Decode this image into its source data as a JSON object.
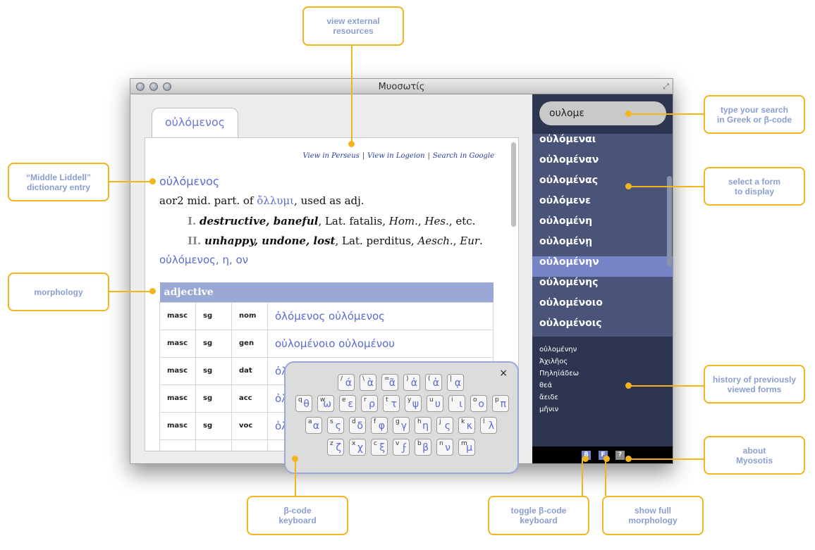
{
  "window": {
    "title": "Μυοσωτίς"
  },
  "tab": {
    "label": "οὐλόμενος"
  },
  "external": {
    "perseus": "View in Perseus",
    "logeion": "View in Logeion",
    "google": "Search in Google",
    "sep": "|"
  },
  "entry": {
    "headword": "οὐλόμενος",
    "def_prefix": "aor2 mid. part. of ",
    "def_ref": "ὄλλυμι",
    "def_suffix": ", used as adj.",
    "sense1": {
      "num": "I.",
      "bold": "destructive, baneful",
      "text1": ", Lat. fatalis, ",
      "ref1": "Hom.",
      "sep1": ", ",
      "ref2": "Hes.",
      "text2": ", etc."
    },
    "sense2": {
      "num": "II.",
      "bold": "unhappy, undone, lost",
      "text1": ", Lat. perditus, ",
      "ref1": "Aesch.",
      "sep1": ", ",
      "ref2": "Eur",
      "text2": "."
    },
    "lemma": "οὐλόμενος, η, ον"
  },
  "morphology": {
    "header": "adjective",
    "rows": [
      {
        "gender": "masc",
        "number": "sg",
        "case": "nom",
        "forms": "ὀλόμενος  οὐλόμενος"
      },
      {
        "gender": "masc",
        "number": "sg",
        "case": "gen",
        "forms": "οὐλομένοιο  οὐλομένου"
      },
      {
        "gender": "masc",
        "number": "sg",
        "case": "dat",
        "forms": "ὀλ"
      },
      {
        "gender": "masc",
        "number": "sg",
        "case": "acc",
        "forms": "ὀλ"
      },
      {
        "gender": "masc",
        "number": "sg",
        "case": "voc",
        "forms": "ὀλ"
      },
      {
        "gender": "",
        "number": "",
        "case": "",
        "forms": ""
      }
    ]
  },
  "search": {
    "value": "ουλομε"
  },
  "forms": [
    "οὐλόμεναι",
    "οὐλομέναν",
    "οὐλομένας",
    "οὐλόμενε",
    "οὐλομένη",
    "οὐλομένῃ",
    "οὐλομένην",
    "οὐλομένης",
    "οὐλομένοιο",
    "οὐλομένοις"
  ],
  "history": [
    "οὐλομένην",
    "Ἀχιλῆος",
    "Πηληϊάδεω",
    "θεά",
    "ἄειδε",
    "μῆνιν"
  ],
  "bottombar": {
    "beta": "β",
    "morph": "F",
    "about": "?"
  },
  "keyboard": {
    "close": "×",
    "row1": [
      [
        "/",
        "ά"
      ],
      [
        "\\",
        "ὰ"
      ],
      [
        "=",
        "ᾶ"
      ],
      [
        ")",
        "ἀ"
      ],
      [
        "(",
        "ἁ"
      ],
      [
        "|",
        "ᾳ"
      ]
    ],
    "row2": [
      [
        "q",
        "θ"
      ],
      [
        "w",
        "ω"
      ],
      [
        "e",
        "ε"
      ],
      [
        "r",
        "ρ"
      ],
      [
        "t",
        "τ"
      ],
      [
        "y",
        "ψ"
      ],
      [
        "u",
        "υ"
      ],
      [
        "i",
        "ι"
      ],
      [
        "o",
        "ο"
      ],
      [
        "p",
        "π"
      ]
    ],
    "row3": [
      [
        "a",
        "α"
      ],
      [
        "s",
        "ς"
      ],
      [
        "d",
        "δ"
      ],
      [
        "f",
        "φ"
      ],
      [
        "g",
        "γ"
      ],
      [
        "h",
        "η"
      ],
      [
        "j",
        "ς"
      ],
      [
        "k",
        "κ"
      ],
      [
        "l",
        "λ"
      ]
    ],
    "row4": [
      [
        "z",
        "ζ"
      ],
      [
        "x",
        "χ"
      ],
      [
        "c",
        "ξ"
      ],
      [
        "v",
        "ϝ"
      ],
      [
        "b",
        "β"
      ],
      [
        "n",
        "ν"
      ],
      [
        "m",
        "μ"
      ]
    ]
  },
  "callouts": {
    "external": "view external\nresources",
    "liddell": "“Middle Liddell”\ndictionary entry",
    "morphology": "morphology",
    "search": "type your search\nin Greek or β-code",
    "select": "select a form\nto display",
    "history": "history of previously\nviewed forms",
    "about": "about\nMyosotis",
    "bcode": "β-code\nkeyboard",
    "toggle": "toggle β-code\nkeyboard",
    "full": "show full\nmorphology"
  },
  "colors": {
    "accent": "#f2b51d",
    "greek": "#5a6ad4",
    "sidebar": "#2e3550",
    "selected": "#7585c8"
  }
}
